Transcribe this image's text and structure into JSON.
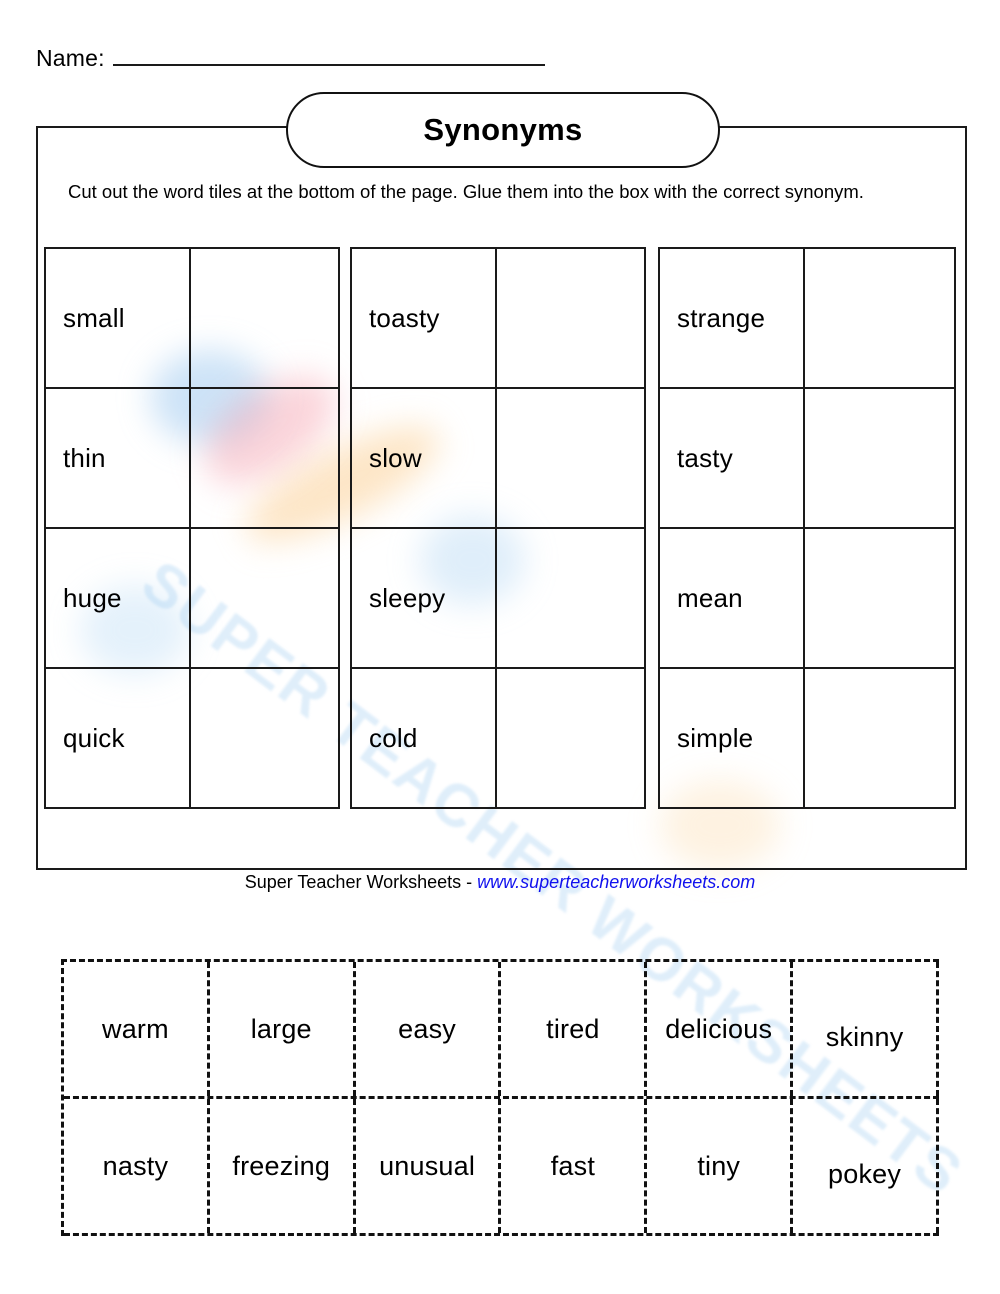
{
  "header": {
    "name_label": "Name:"
  },
  "title": {
    "text": "Synonyms"
  },
  "instructions": {
    "text": "Cut out the word tiles at the bottom of the page.  Glue them into the box with the correct synonym."
  },
  "word_tables": [
    {
      "rows": [
        {
          "word": "small",
          "answer": ""
        },
        {
          "word": "thin",
          "answer": ""
        },
        {
          "word": "huge",
          "answer": ""
        },
        {
          "word": "quick",
          "answer": ""
        }
      ]
    },
    {
      "rows": [
        {
          "word": "toasty",
          "answer": ""
        },
        {
          "word": "slow",
          "answer": ""
        },
        {
          "word": "sleepy",
          "answer": ""
        },
        {
          "word": "cold",
          "answer": ""
        }
      ]
    },
    {
      "rows": [
        {
          "word": "strange",
          "answer": ""
        },
        {
          "word": "tasty",
          "answer": ""
        },
        {
          "word": "mean",
          "answer": ""
        },
        {
          "word": "simple",
          "answer": ""
        }
      ]
    }
  ],
  "tile_grid": {
    "rows": [
      [
        "warm",
        "large",
        "easy",
        "tired",
        "delicious",
        "skinny"
      ],
      [
        "nasty",
        "freezing",
        "unusual",
        "fast",
        "tiny",
        "pokey"
      ]
    ]
  },
  "footer": {
    "credit_name": "Super Teacher Worksheets - ",
    "credit_url": "www.superteacherworksheets.com"
  },
  "watermark": {
    "text": "SUPER TEACHER WORKSHEETS"
  },
  "colors": {
    "ink": "#1a1a1a",
    "link_blue": "#1111ee",
    "page_bg": "#ffffff"
  }
}
